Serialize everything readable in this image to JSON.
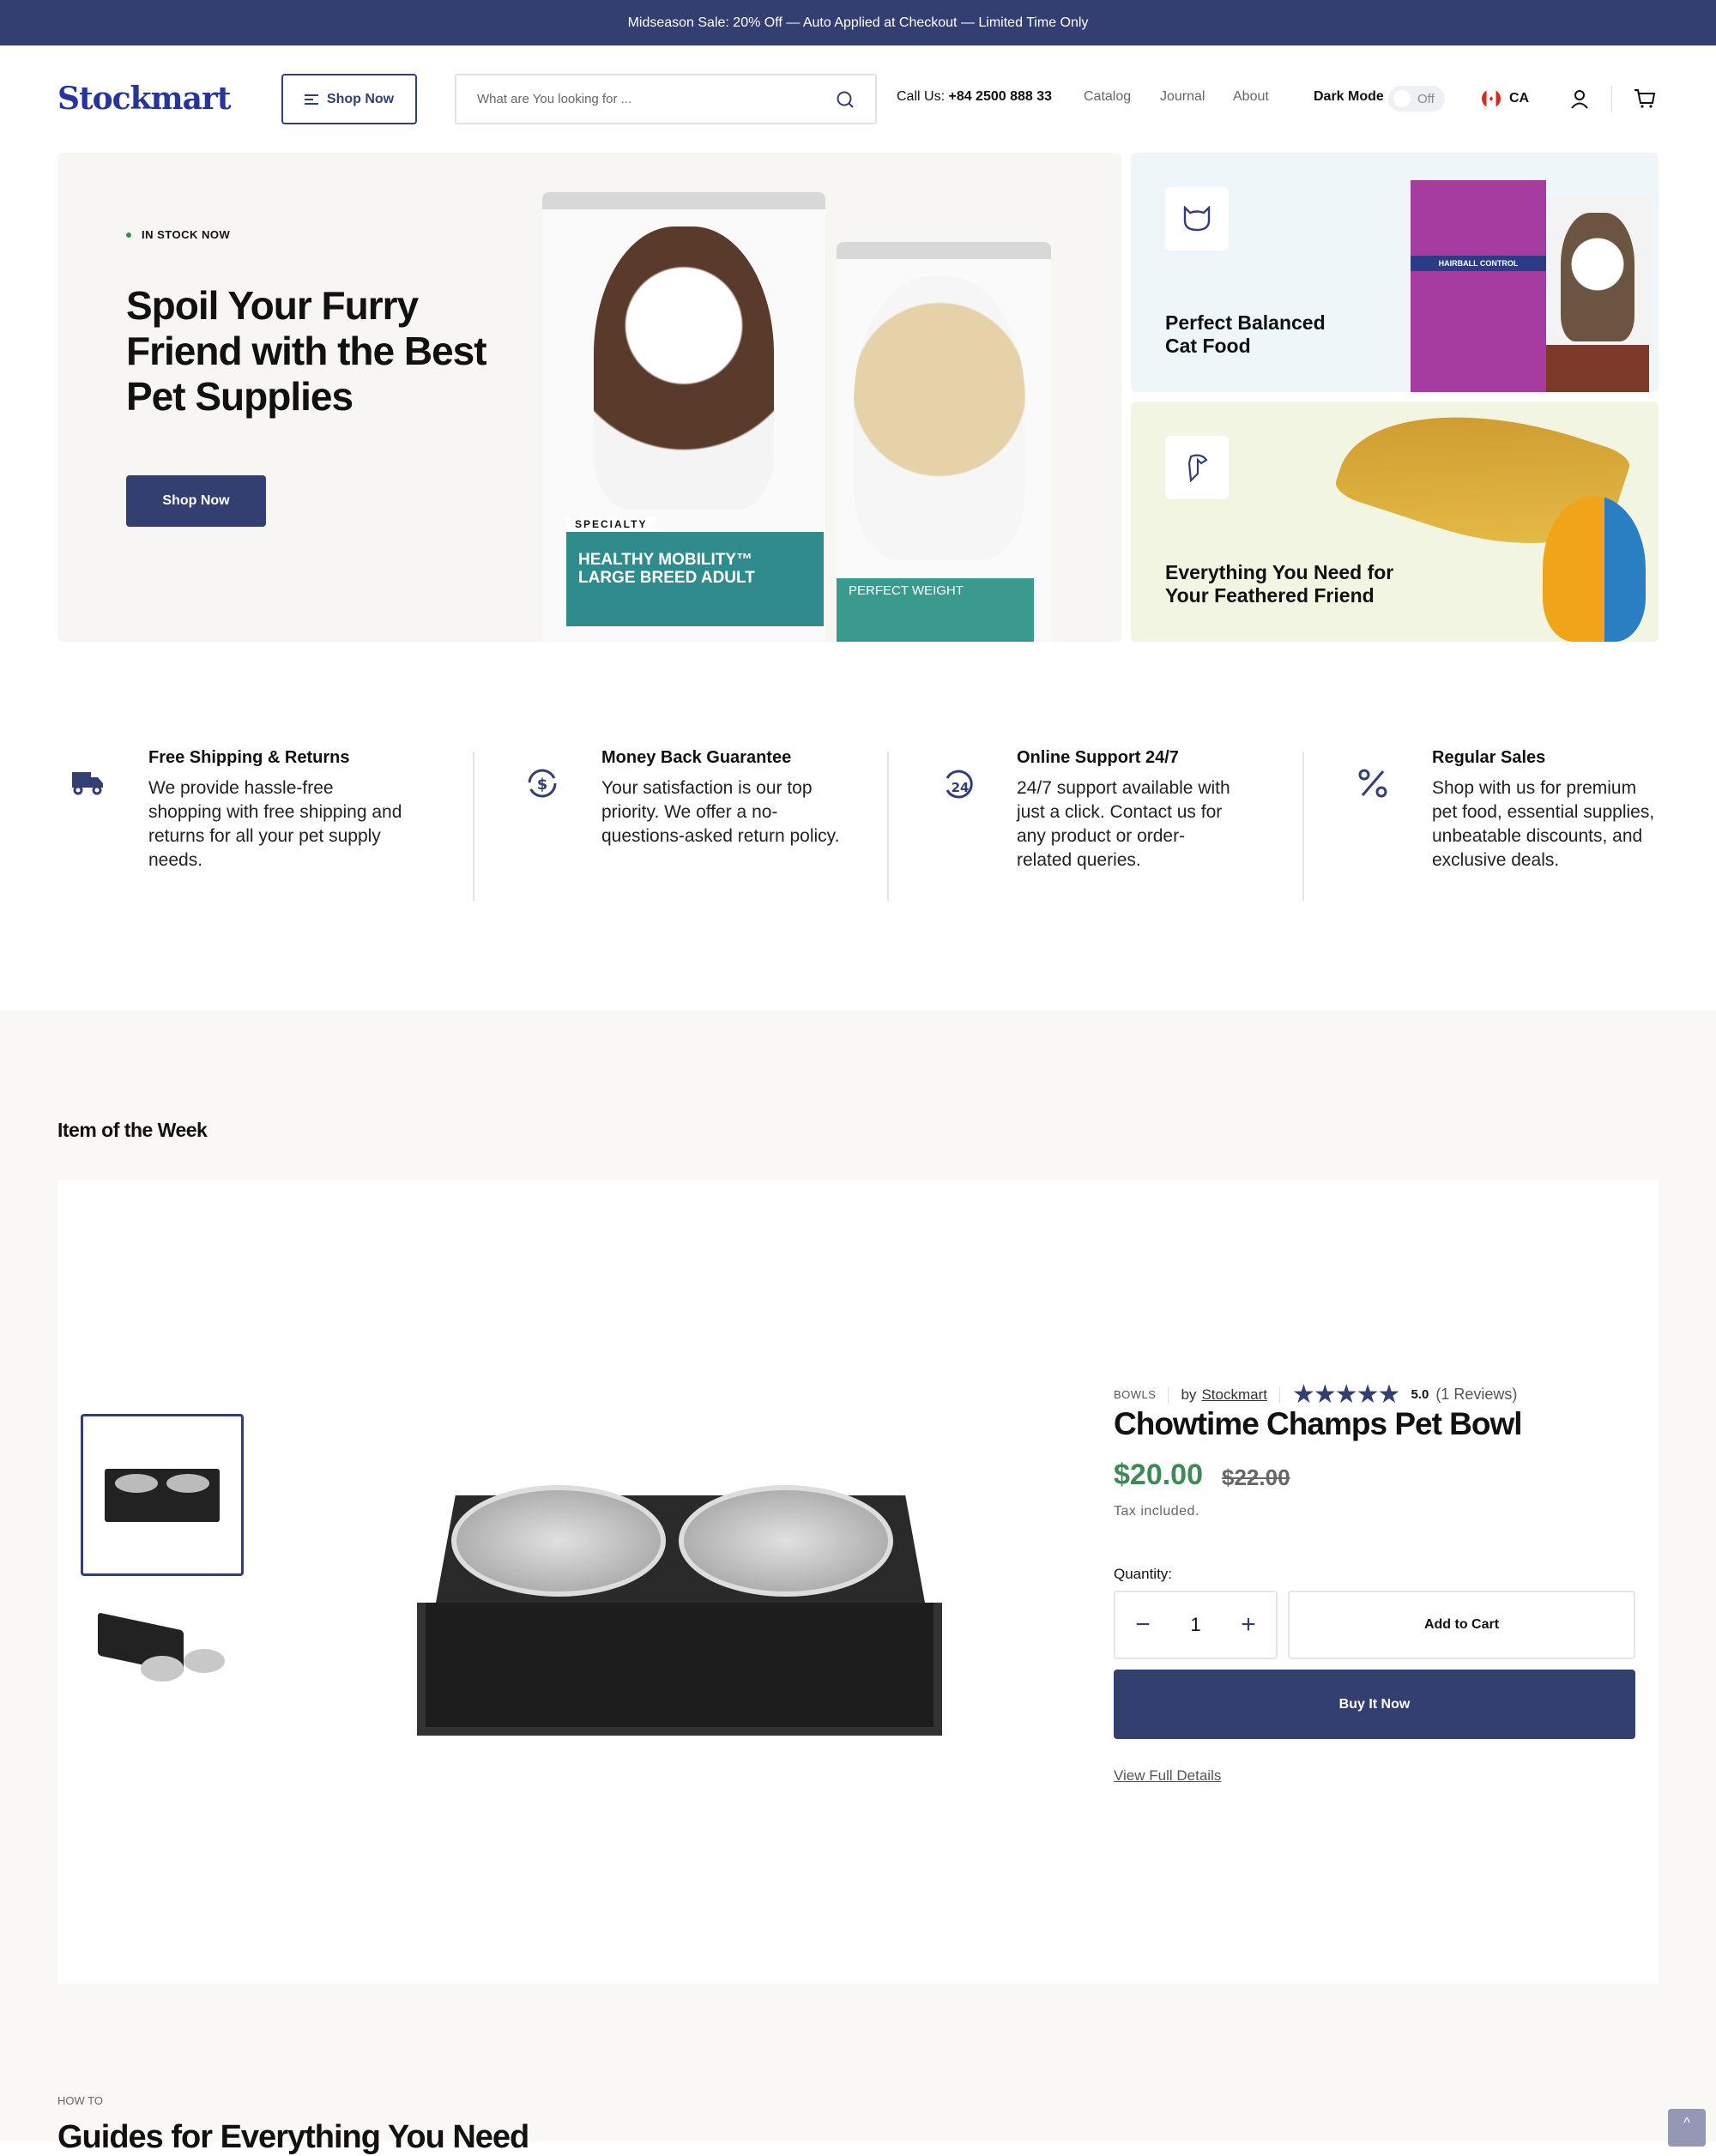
{
  "announcement": "Midseason Sale: 20% Off — Auto Applied at Checkout — Limited Time Only",
  "header": {
    "logo": "Stockmart",
    "shop_now": "Shop Now",
    "search_placeholder": "What are You looking for ...",
    "call_label": "Call Us:",
    "phone": "+84 2500 888 33",
    "nav": [
      "Catalog",
      "Journal",
      "About"
    ],
    "dark_mode_label": "Dark Mode",
    "dark_mode_state": "Off",
    "country": "CA"
  },
  "hero": {
    "badge": "IN STOCK NOW",
    "title": "Spoil Your Furry Friend with the Best Pet Supplies",
    "cta": "Shop Now",
    "bag1_label": "HEALTHY MOBILITY™ LARGE BREED ADULT",
    "bag1_top": "SPECIALTY",
    "bag2_label": "PERFECT WEIGHT"
  },
  "promos": [
    {
      "title": "Perfect Balanced Cat Food",
      "icon": "cat-icon",
      "bag_label": "HAIRBALL CONTROL"
    },
    {
      "title": "Everything You Need for Your Feathered Friend",
      "icon": "parrot-icon"
    }
  ],
  "features": [
    {
      "icon": "truck-icon",
      "title": "Free Shipping & Returns",
      "text": "We provide hassle-free shopping with free shipping and returns for all your pet supply needs."
    },
    {
      "icon": "money-back-icon",
      "title": "Money Back Guarantee",
      "text": "Your satisfaction is our top priority. We offer a no-questions-asked return policy."
    },
    {
      "icon": "support-24-icon",
      "title": "Online Support 24/7",
      "text": "24/7 support available with just a click. Contact us for any product or order-related queries."
    },
    {
      "icon": "percent-icon",
      "title": "Regular Sales",
      "text": "Shop with us for premium pet food, essential supplies, unbeatable discounts, and exclusive deals."
    }
  ],
  "item_of_week": {
    "heading": "Item of the Week",
    "category": "BOWLS",
    "by": "by",
    "vendor": "Stockmart",
    "rating": 5,
    "rating_text": "5.0",
    "reviews": "(1 Reviews)",
    "title": "Chowtime Champs Pet Bowl",
    "price": "$20.00",
    "compare_price": "$22.00",
    "tax": "Tax included.",
    "quantity_label": "Quantity:",
    "quantity": "1",
    "add_to_cart": "Add to Cart",
    "buy_now": "Buy It Now",
    "details_link": "View Full Details"
  },
  "guides": {
    "eyebrow": "HOW TO",
    "heading": "Guides for Everything You Need"
  },
  "colors": {
    "primary": "#333f70",
    "price": "#3e8a55",
    "section_bg": "#f9f8f4"
  }
}
